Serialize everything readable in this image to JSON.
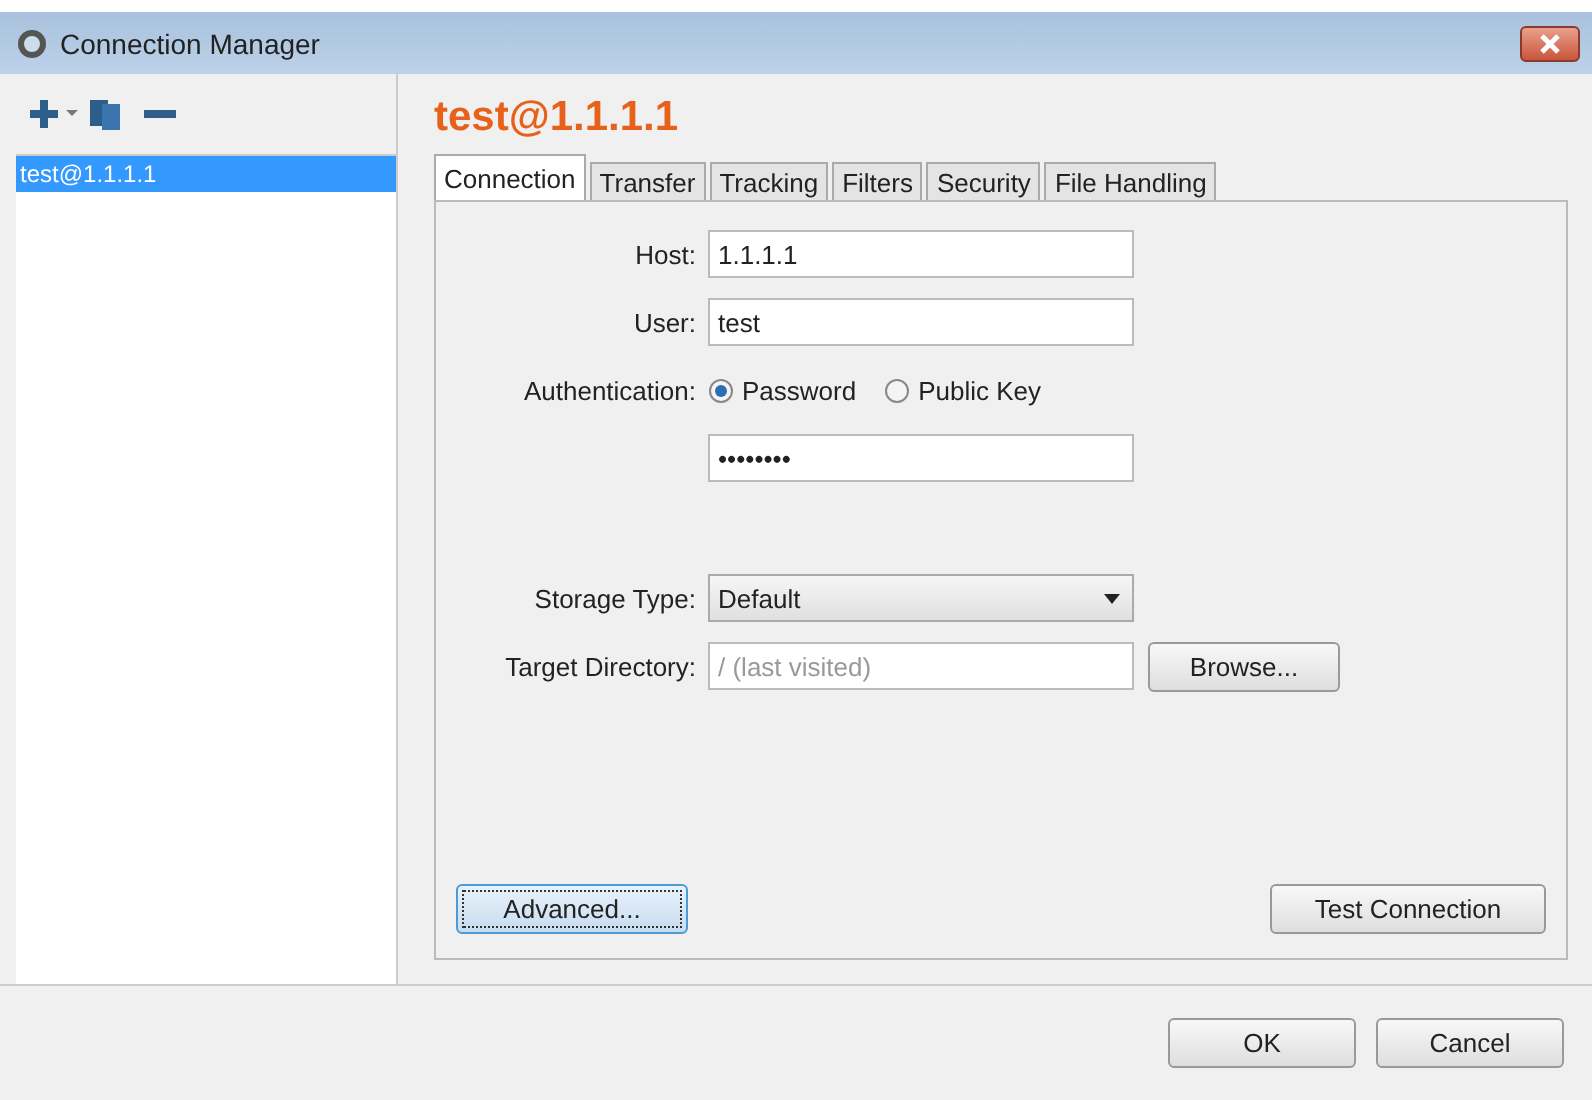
{
  "window": {
    "title": "Connection Manager"
  },
  "sidebar": {
    "items": [
      {
        "label": "test@1.1.1.1",
        "selected": true
      }
    ]
  },
  "heading": "test@1.1.1.1",
  "tabs": [
    {
      "label": "Connection",
      "selected": true
    },
    {
      "label": "Transfer",
      "selected": false
    },
    {
      "label": "Tracking",
      "selected": false
    },
    {
      "label": "Filters",
      "selected": false
    },
    {
      "label": "Security",
      "selected": false
    },
    {
      "label": "File Handling",
      "selected": false
    }
  ],
  "form": {
    "host": {
      "label": "Host:",
      "value": "1.1.1.1"
    },
    "user": {
      "label": "User:",
      "value": "test"
    },
    "authentication": {
      "label": "Authentication:",
      "options": [
        {
          "label": "Password",
          "selected": true
        },
        {
          "label": "Public Key",
          "selected": false
        }
      ]
    },
    "password": {
      "value": "••••••••"
    },
    "storage_type": {
      "label": "Storage Type:",
      "value": "Default"
    },
    "target_directory": {
      "label": "Target Directory:",
      "placeholder": "/ (last visited)",
      "button": "Browse..."
    }
  },
  "panel_buttons": [
    {
      "label": "Advanced...",
      "focused": true
    },
    {
      "label": "Test Connection",
      "focused": false
    }
  ],
  "buttons": [
    "OK",
    "Cancel"
  ]
}
